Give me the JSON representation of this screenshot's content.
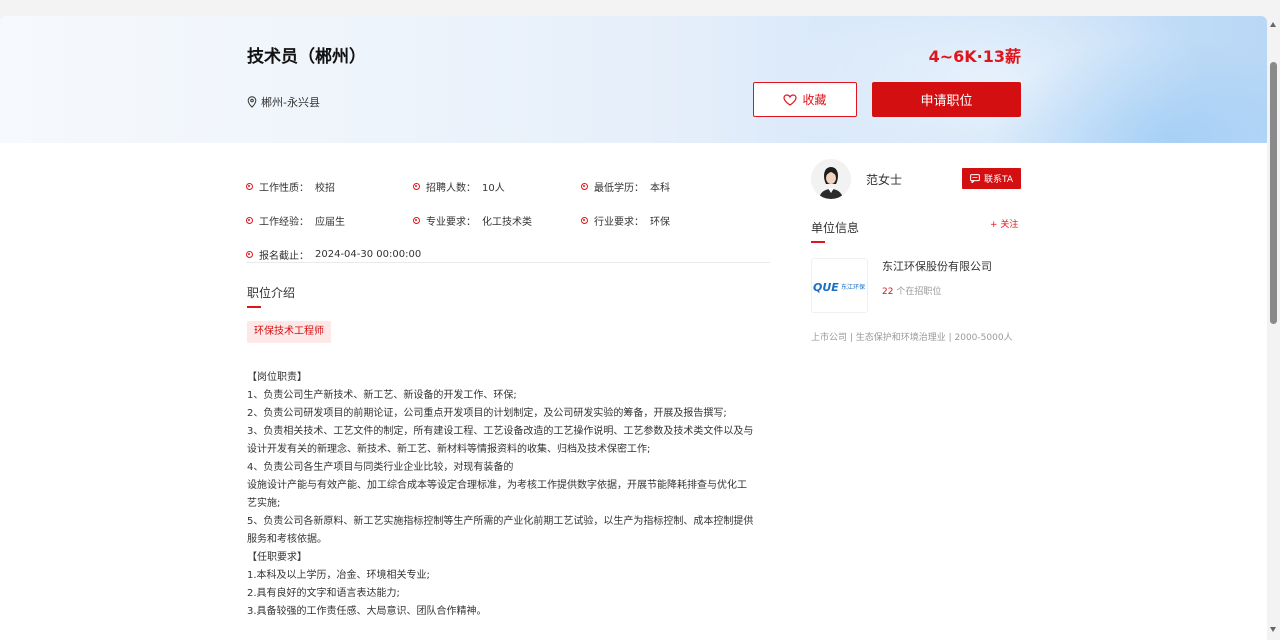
{
  "job": {
    "title": "技术员（郴州）",
    "salary": "4~6K·13薪",
    "location": "郴州-永兴县"
  },
  "actions": {
    "favorite_label": "收藏",
    "apply_label": "申请职位"
  },
  "attributes": [
    {
      "key": "工作性质：",
      "value": "校招"
    },
    {
      "key": "招聘人数：",
      "value": "10人"
    },
    {
      "key": "最低学历：",
      "value": "本科"
    },
    {
      "key": "工作经验：",
      "value": "应届生"
    },
    {
      "key": "专业要求：",
      "value": "化工技术类"
    },
    {
      "key": "行业要求：",
      "value": "环保"
    },
    {
      "key": "报名截止：",
      "value": "2024-04-30 00:00:00"
    }
  ],
  "intro": {
    "section_title": "职位介绍",
    "tag": "环保技术工程师",
    "lines": [
      "【岗位职责】",
      "1、负责公司生产新技术、新工艺、新设备的开发工作、环保;",
      "2、负责公司研发项目的前期论证，公司重点开发项目的计划制定，及公司研发实验的筹备，开展及报告撰写;",
      "3、负责相关技术、工艺文件的制定，所有建设工程、工艺设备改造的工艺操作说明、工艺参数及技术类文件以及与",
      "设计开发有关的新理念、新技术、新工艺、新材料等情报资料的收集、归档及技术保密工作;",
      "4、负责公司各生产项目与同类行业企业比较，对现有装备的",
      "设施设计产能与有效产能、加工综合成本等设定合理标准，为考核工作提供数字依据，开展节能降耗排查与优化工",
      "艺实施;",
      "5、负责公司各新原料、新工艺实施指标控制等生产所需的产业化前期工艺试验，以生产为指标控制、成本控制提供",
      "服务和考核依据。",
      "【任职要求】",
      "1.本科及以上学历，冶金、环境相关专业;",
      "2.具有良好的文字和语言表达能力;",
      "3.具备较强的工作责任感、大局意识、团队合作精神。"
    ]
  },
  "recruiter": {
    "name": "范女士",
    "contact_label": "联系TA"
  },
  "company": {
    "section_title": "单位信息",
    "follow_label": "+ 关注",
    "name": "东江环保股份有限公司",
    "jobs_count": "22",
    "jobs_suffix": " 个在招职位",
    "meta": "上市公司 | 生态保护和环境治理业 | 2000-5000人",
    "logo_text": "QUE",
    "logo_sub": "东江环保"
  },
  "colors": {
    "accent": "#e0151b",
    "apply_bg": "#d40f12"
  },
  "icons": [
    "location-pin-icon",
    "heart-icon",
    "chat-icon",
    "scroll-up-icon",
    "scroll-down-icon"
  ]
}
